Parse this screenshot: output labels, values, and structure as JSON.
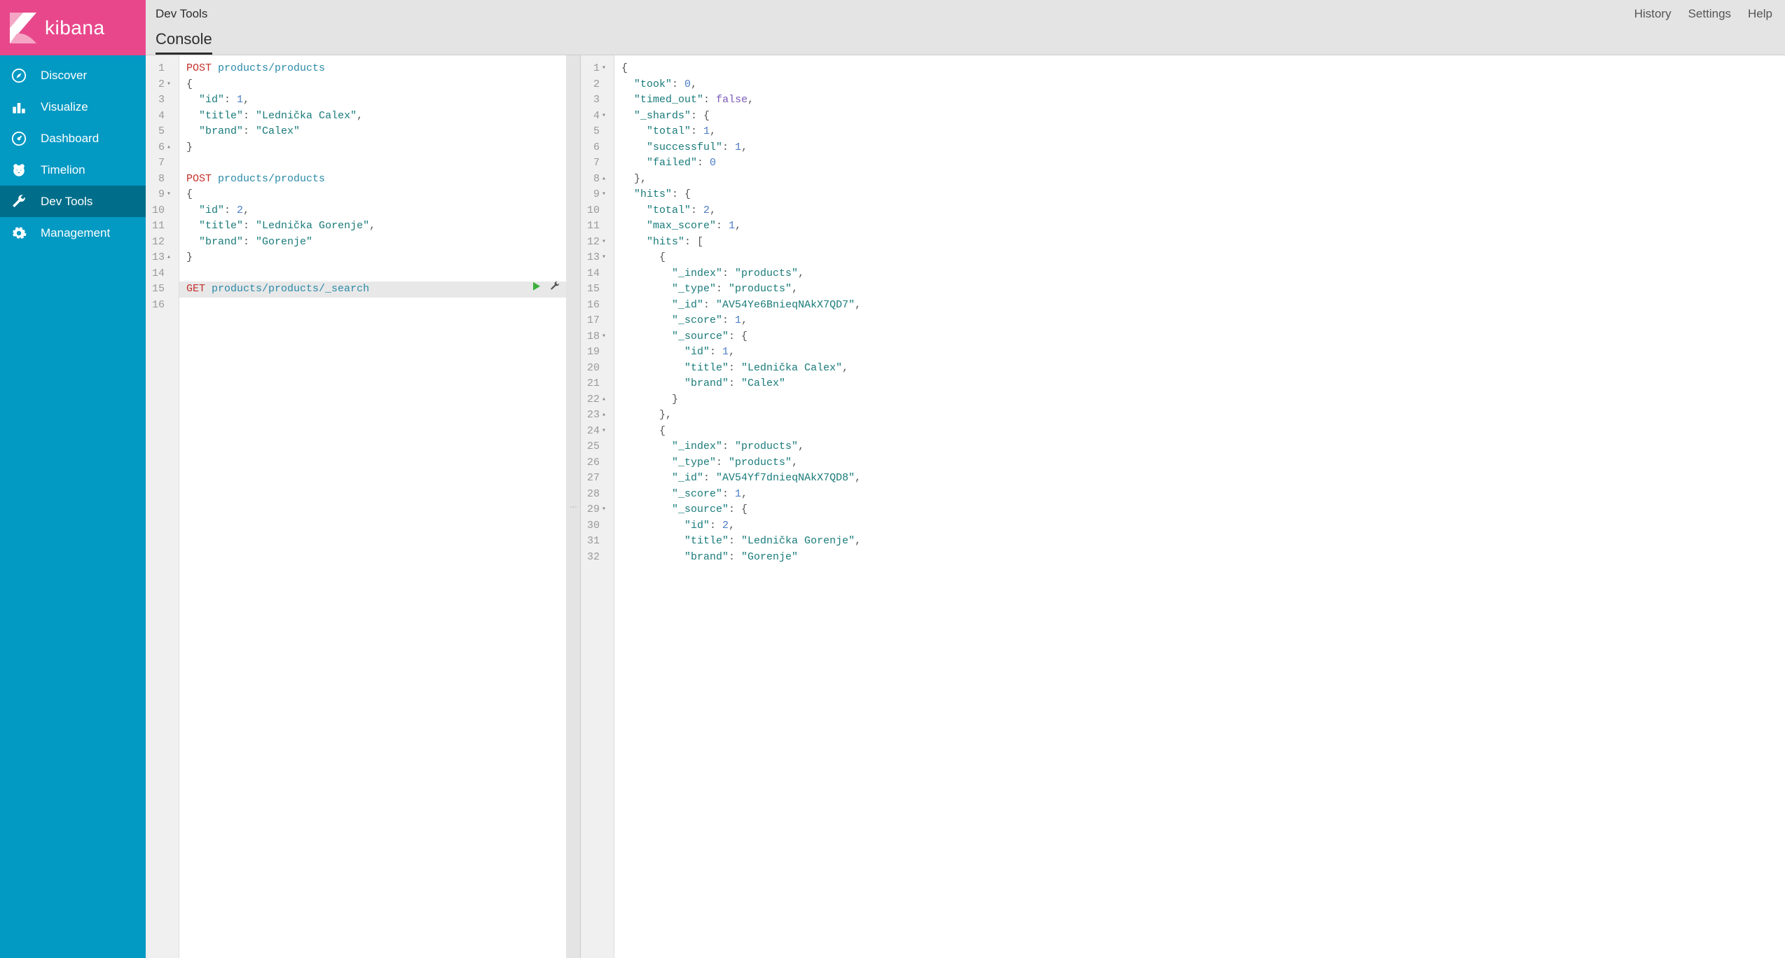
{
  "brand": "kibana",
  "sidebar": {
    "items": [
      {
        "label": "Discover",
        "icon": "compass"
      },
      {
        "label": "Visualize",
        "icon": "bar-chart"
      },
      {
        "label": "Dashboard",
        "icon": "gauge"
      },
      {
        "label": "Timelion",
        "icon": "bear"
      },
      {
        "label": "Dev Tools",
        "icon": "wrench"
      },
      {
        "label": "Management",
        "icon": "gear"
      }
    ],
    "active_index": 4
  },
  "header": {
    "breadcrumb": "Dev Tools",
    "tabs": [
      "Console"
    ],
    "active_tab": 0,
    "actions": [
      "History",
      "Settings",
      "Help"
    ]
  },
  "request_editor": {
    "lines": [
      {
        "n": 1,
        "fold": "",
        "tokens": [
          [
            "method-post",
            "POST"
          ],
          [
            "",
            " "
          ],
          [
            "path",
            "products/products"
          ]
        ]
      },
      {
        "n": 2,
        "fold": "▾",
        "tokens": [
          [
            "brace",
            "{"
          ]
        ]
      },
      {
        "n": 3,
        "fold": "",
        "tokens": [
          [
            "",
            "  "
          ],
          [
            "key",
            "\"id\""
          ],
          [
            "punc",
            ": "
          ],
          [
            "number",
            "1"
          ],
          [
            "punc",
            ","
          ]
        ]
      },
      {
        "n": 4,
        "fold": "",
        "tokens": [
          [
            "",
            "  "
          ],
          [
            "key",
            "\"title\""
          ],
          [
            "punc",
            ": "
          ],
          [
            "string",
            "\"Lednička Calex\""
          ],
          [
            "punc",
            ","
          ]
        ]
      },
      {
        "n": 5,
        "fold": "",
        "tokens": [
          [
            "",
            "  "
          ],
          [
            "key",
            "\"brand\""
          ],
          [
            "punc",
            ": "
          ],
          [
            "string",
            "\"Calex\""
          ]
        ]
      },
      {
        "n": 6,
        "fold": "▴",
        "tokens": [
          [
            "brace",
            "}"
          ]
        ]
      },
      {
        "n": 7,
        "fold": "",
        "tokens": []
      },
      {
        "n": 8,
        "fold": "",
        "tokens": [
          [
            "method-post",
            "POST"
          ],
          [
            "",
            " "
          ],
          [
            "path",
            "products/products"
          ]
        ]
      },
      {
        "n": 9,
        "fold": "▾",
        "tokens": [
          [
            "brace",
            "{"
          ]
        ]
      },
      {
        "n": 10,
        "fold": "",
        "tokens": [
          [
            "",
            "  "
          ],
          [
            "key",
            "\"id\""
          ],
          [
            "punc",
            ": "
          ],
          [
            "number",
            "2"
          ],
          [
            "punc",
            ","
          ]
        ]
      },
      {
        "n": 11,
        "fold": "",
        "tokens": [
          [
            "",
            "  "
          ],
          [
            "key",
            "\"title\""
          ],
          [
            "punc",
            ": "
          ],
          [
            "string",
            "\"Lednička Gorenje\""
          ],
          [
            "punc",
            ","
          ]
        ]
      },
      {
        "n": 12,
        "fold": "",
        "tokens": [
          [
            "",
            "  "
          ],
          [
            "key",
            "\"brand\""
          ],
          [
            "punc",
            ": "
          ],
          [
            "string",
            "\"Gorenje\""
          ]
        ]
      },
      {
        "n": 13,
        "fold": "▴",
        "tokens": [
          [
            "brace",
            "}"
          ]
        ]
      },
      {
        "n": 14,
        "fold": "",
        "tokens": []
      },
      {
        "n": 15,
        "fold": "",
        "highlighted": true,
        "tokens": [
          [
            "method-get",
            "GET"
          ],
          [
            "",
            " "
          ],
          [
            "path",
            "products/products/_search"
          ]
        ]
      },
      {
        "n": 16,
        "fold": "",
        "tokens": []
      }
    ]
  },
  "response_editor": {
    "lines": [
      {
        "n": 1,
        "fold": "▾",
        "tokens": [
          [
            "brace",
            "{"
          ]
        ]
      },
      {
        "n": 2,
        "fold": "",
        "tokens": [
          [
            "",
            "  "
          ],
          [
            "key",
            "\"took\""
          ],
          [
            "punc",
            ": "
          ],
          [
            "number",
            "0"
          ],
          [
            "punc",
            ","
          ]
        ]
      },
      {
        "n": 3,
        "fold": "",
        "tokens": [
          [
            "",
            "  "
          ],
          [
            "key",
            "\"timed_out\""
          ],
          [
            "punc",
            ": "
          ],
          [
            "bool",
            "false"
          ],
          [
            "punc",
            ","
          ]
        ]
      },
      {
        "n": 4,
        "fold": "▾",
        "tokens": [
          [
            "",
            "  "
          ],
          [
            "key",
            "\"_shards\""
          ],
          [
            "punc",
            ": "
          ],
          [
            "brace",
            "{"
          ]
        ]
      },
      {
        "n": 5,
        "fold": "",
        "tokens": [
          [
            "",
            "    "
          ],
          [
            "key",
            "\"total\""
          ],
          [
            "punc",
            ": "
          ],
          [
            "number",
            "1"
          ],
          [
            "punc",
            ","
          ]
        ]
      },
      {
        "n": 6,
        "fold": "",
        "tokens": [
          [
            "",
            "    "
          ],
          [
            "key",
            "\"successful\""
          ],
          [
            "punc",
            ": "
          ],
          [
            "number",
            "1"
          ],
          [
            "punc",
            ","
          ]
        ]
      },
      {
        "n": 7,
        "fold": "",
        "tokens": [
          [
            "",
            "    "
          ],
          [
            "key",
            "\"failed\""
          ],
          [
            "punc",
            ": "
          ],
          [
            "number",
            "0"
          ]
        ]
      },
      {
        "n": 8,
        "fold": "▴",
        "tokens": [
          [
            "",
            "  "
          ],
          [
            "brace",
            "},"
          ]
        ]
      },
      {
        "n": 9,
        "fold": "▾",
        "tokens": [
          [
            "",
            "  "
          ],
          [
            "key",
            "\"hits\""
          ],
          [
            "punc",
            ": "
          ],
          [
            "brace",
            "{"
          ]
        ]
      },
      {
        "n": 10,
        "fold": "",
        "tokens": [
          [
            "",
            "    "
          ],
          [
            "key",
            "\"total\""
          ],
          [
            "punc",
            ": "
          ],
          [
            "number",
            "2"
          ],
          [
            "punc",
            ","
          ]
        ]
      },
      {
        "n": 11,
        "fold": "",
        "tokens": [
          [
            "",
            "    "
          ],
          [
            "key",
            "\"max_score\""
          ],
          [
            "punc",
            ": "
          ],
          [
            "number",
            "1"
          ],
          [
            "punc",
            ","
          ]
        ]
      },
      {
        "n": 12,
        "fold": "▾",
        "tokens": [
          [
            "",
            "    "
          ],
          [
            "key",
            "\"hits\""
          ],
          [
            "punc",
            ": "
          ],
          [
            "brace",
            "["
          ]
        ]
      },
      {
        "n": 13,
        "fold": "▾",
        "tokens": [
          [
            "",
            "      "
          ],
          [
            "brace",
            "{"
          ]
        ]
      },
      {
        "n": 14,
        "fold": "",
        "tokens": [
          [
            "",
            "        "
          ],
          [
            "key",
            "\"_index\""
          ],
          [
            "punc",
            ": "
          ],
          [
            "string",
            "\"products\""
          ],
          [
            "punc",
            ","
          ]
        ]
      },
      {
        "n": 15,
        "fold": "",
        "tokens": [
          [
            "",
            "        "
          ],
          [
            "key",
            "\"_type\""
          ],
          [
            "punc",
            ": "
          ],
          [
            "string",
            "\"products\""
          ],
          [
            "punc",
            ","
          ]
        ]
      },
      {
        "n": 16,
        "fold": "",
        "tokens": [
          [
            "",
            "        "
          ],
          [
            "key",
            "\"_id\""
          ],
          [
            "punc",
            ": "
          ],
          [
            "string",
            "\"AV54Ye6BnieqNAkX7QD7\""
          ],
          [
            "punc",
            ","
          ]
        ]
      },
      {
        "n": 17,
        "fold": "",
        "tokens": [
          [
            "",
            "        "
          ],
          [
            "key",
            "\"_score\""
          ],
          [
            "punc",
            ": "
          ],
          [
            "number",
            "1"
          ],
          [
            "punc",
            ","
          ]
        ]
      },
      {
        "n": 18,
        "fold": "▾",
        "tokens": [
          [
            "",
            "        "
          ],
          [
            "key",
            "\"_source\""
          ],
          [
            "punc",
            ": "
          ],
          [
            "brace",
            "{"
          ]
        ]
      },
      {
        "n": 19,
        "fold": "",
        "tokens": [
          [
            "",
            "          "
          ],
          [
            "key",
            "\"id\""
          ],
          [
            "punc",
            ": "
          ],
          [
            "number",
            "1"
          ],
          [
            "punc",
            ","
          ]
        ]
      },
      {
        "n": 20,
        "fold": "",
        "tokens": [
          [
            "",
            "          "
          ],
          [
            "key",
            "\"title\""
          ],
          [
            "punc",
            ": "
          ],
          [
            "string",
            "\"Lednička Calex\""
          ],
          [
            "punc",
            ","
          ]
        ]
      },
      {
        "n": 21,
        "fold": "",
        "tokens": [
          [
            "",
            "          "
          ],
          [
            "key",
            "\"brand\""
          ],
          [
            "punc",
            ": "
          ],
          [
            "string",
            "\"Calex\""
          ]
        ]
      },
      {
        "n": 22,
        "fold": "▴",
        "tokens": [
          [
            "",
            "        "
          ],
          [
            "brace",
            "}"
          ]
        ]
      },
      {
        "n": 23,
        "fold": "▴",
        "tokens": [
          [
            "",
            "      "
          ],
          [
            "brace",
            "},"
          ]
        ]
      },
      {
        "n": 24,
        "fold": "▾",
        "tokens": [
          [
            "",
            "      "
          ],
          [
            "brace",
            "{"
          ]
        ]
      },
      {
        "n": 25,
        "fold": "",
        "tokens": [
          [
            "",
            "        "
          ],
          [
            "key",
            "\"_index\""
          ],
          [
            "punc",
            ": "
          ],
          [
            "string",
            "\"products\""
          ],
          [
            "punc",
            ","
          ]
        ]
      },
      {
        "n": 26,
        "fold": "",
        "tokens": [
          [
            "",
            "        "
          ],
          [
            "key",
            "\"_type\""
          ],
          [
            "punc",
            ": "
          ],
          [
            "string",
            "\"products\""
          ],
          [
            "punc",
            ","
          ]
        ]
      },
      {
        "n": 27,
        "fold": "",
        "tokens": [
          [
            "",
            "        "
          ],
          [
            "key",
            "\"_id\""
          ],
          [
            "punc",
            ": "
          ],
          [
            "string",
            "\"AV54Yf7dnieqNAkX7QD8\""
          ],
          [
            "punc",
            ","
          ]
        ]
      },
      {
        "n": 28,
        "fold": "",
        "tokens": [
          [
            "",
            "        "
          ],
          [
            "key",
            "\"_score\""
          ],
          [
            "punc",
            ": "
          ],
          [
            "number",
            "1"
          ],
          [
            "punc",
            ","
          ]
        ]
      },
      {
        "n": 29,
        "fold": "▾",
        "tokens": [
          [
            "",
            "        "
          ],
          [
            "key",
            "\"_source\""
          ],
          [
            "punc",
            ": "
          ],
          [
            "brace",
            "{"
          ]
        ]
      },
      {
        "n": 30,
        "fold": "",
        "tokens": [
          [
            "",
            "          "
          ],
          [
            "key",
            "\"id\""
          ],
          [
            "punc",
            ": "
          ],
          [
            "number",
            "2"
          ],
          [
            "punc",
            ","
          ]
        ]
      },
      {
        "n": 31,
        "fold": "",
        "tokens": [
          [
            "",
            "          "
          ],
          [
            "key",
            "\"title\""
          ],
          [
            "punc",
            ": "
          ],
          [
            "string",
            "\"Lednička Gorenje\""
          ],
          [
            "punc",
            ","
          ]
        ]
      },
      {
        "n": 32,
        "fold": "",
        "tokens": [
          [
            "",
            "          "
          ],
          [
            "key",
            "\"brand\""
          ],
          [
            "punc",
            ": "
          ],
          [
            "string",
            "\"Gorenje\""
          ]
        ]
      }
    ]
  }
}
